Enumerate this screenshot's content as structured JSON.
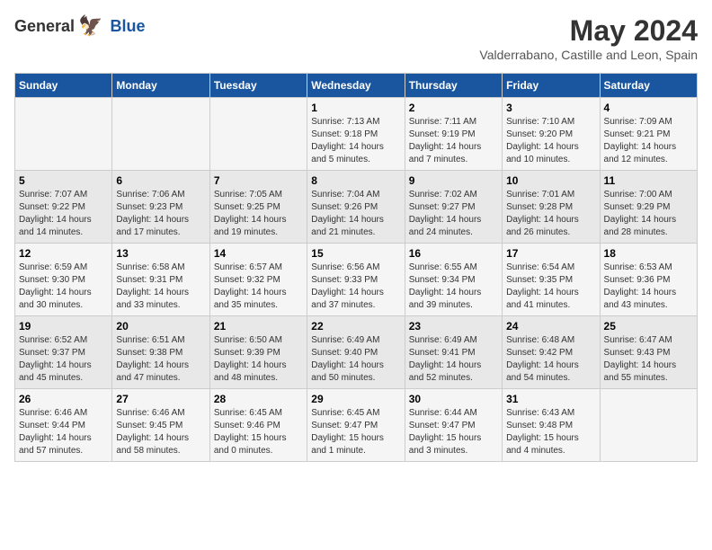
{
  "logo": {
    "general": "General",
    "blue": "Blue"
  },
  "title": "May 2024",
  "subtitle": "Valderrabano, Castille and Leon, Spain",
  "days_of_week": [
    "Sunday",
    "Monday",
    "Tuesday",
    "Wednesday",
    "Thursday",
    "Friday",
    "Saturday"
  ],
  "weeks": [
    [
      {
        "day": "",
        "info": ""
      },
      {
        "day": "",
        "info": ""
      },
      {
        "day": "",
        "info": ""
      },
      {
        "day": "1",
        "sunrise": "Sunrise: 7:13 AM",
        "sunset": "Sunset: 9:18 PM",
        "daylight": "Daylight: 14 hours and 5 minutes."
      },
      {
        "day": "2",
        "sunrise": "Sunrise: 7:11 AM",
        "sunset": "Sunset: 9:19 PM",
        "daylight": "Daylight: 14 hours and 7 minutes."
      },
      {
        "day": "3",
        "sunrise": "Sunrise: 7:10 AM",
        "sunset": "Sunset: 9:20 PM",
        "daylight": "Daylight: 14 hours and 10 minutes."
      },
      {
        "day": "4",
        "sunrise": "Sunrise: 7:09 AM",
        "sunset": "Sunset: 9:21 PM",
        "daylight": "Daylight: 14 hours and 12 minutes."
      }
    ],
    [
      {
        "day": "5",
        "sunrise": "Sunrise: 7:07 AM",
        "sunset": "Sunset: 9:22 PM",
        "daylight": "Daylight: 14 hours and 14 minutes."
      },
      {
        "day": "6",
        "sunrise": "Sunrise: 7:06 AM",
        "sunset": "Sunset: 9:23 PM",
        "daylight": "Daylight: 14 hours and 17 minutes."
      },
      {
        "day": "7",
        "sunrise": "Sunrise: 7:05 AM",
        "sunset": "Sunset: 9:25 PM",
        "daylight": "Daylight: 14 hours and 19 minutes."
      },
      {
        "day": "8",
        "sunrise": "Sunrise: 7:04 AM",
        "sunset": "Sunset: 9:26 PM",
        "daylight": "Daylight: 14 hours and 21 minutes."
      },
      {
        "day": "9",
        "sunrise": "Sunrise: 7:02 AM",
        "sunset": "Sunset: 9:27 PM",
        "daylight": "Daylight: 14 hours and 24 minutes."
      },
      {
        "day": "10",
        "sunrise": "Sunrise: 7:01 AM",
        "sunset": "Sunset: 9:28 PM",
        "daylight": "Daylight: 14 hours and 26 minutes."
      },
      {
        "day": "11",
        "sunrise": "Sunrise: 7:00 AM",
        "sunset": "Sunset: 9:29 PM",
        "daylight": "Daylight: 14 hours and 28 minutes."
      }
    ],
    [
      {
        "day": "12",
        "sunrise": "Sunrise: 6:59 AM",
        "sunset": "Sunset: 9:30 PM",
        "daylight": "Daylight: 14 hours and 30 minutes."
      },
      {
        "day": "13",
        "sunrise": "Sunrise: 6:58 AM",
        "sunset": "Sunset: 9:31 PM",
        "daylight": "Daylight: 14 hours and 33 minutes."
      },
      {
        "day": "14",
        "sunrise": "Sunrise: 6:57 AM",
        "sunset": "Sunset: 9:32 PM",
        "daylight": "Daylight: 14 hours and 35 minutes."
      },
      {
        "day": "15",
        "sunrise": "Sunrise: 6:56 AM",
        "sunset": "Sunset: 9:33 PM",
        "daylight": "Daylight: 14 hours and 37 minutes."
      },
      {
        "day": "16",
        "sunrise": "Sunrise: 6:55 AM",
        "sunset": "Sunset: 9:34 PM",
        "daylight": "Daylight: 14 hours and 39 minutes."
      },
      {
        "day": "17",
        "sunrise": "Sunrise: 6:54 AM",
        "sunset": "Sunset: 9:35 PM",
        "daylight": "Daylight: 14 hours and 41 minutes."
      },
      {
        "day": "18",
        "sunrise": "Sunrise: 6:53 AM",
        "sunset": "Sunset: 9:36 PM",
        "daylight": "Daylight: 14 hours and 43 minutes."
      }
    ],
    [
      {
        "day": "19",
        "sunrise": "Sunrise: 6:52 AM",
        "sunset": "Sunset: 9:37 PM",
        "daylight": "Daylight: 14 hours and 45 minutes."
      },
      {
        "day": "20",
        "sunrise": "Sunrise: 6:51 AM",
        "sunset": "Sunset: 9:38 PM",
        "daylight": "Daylight: 14 hours and 47 minutes."
      },
      {
        "day": "21",
        "sunrise": "Sunrise: 6:50 AM",
        "sunset": "Sunset: 9:39 PM",
        "daylight": "Daylight: 14 hours and 48 minutes."
      },
      {
        "day": "22",
        "sunrise": "Sunrise: 6:49 AM",
        "sunset": "Sunset: 9:40 PM",
        "daylight": "Daylight: 14 hours and 50 minutes."
      },
      {
        "day": "23",
        "sunrise": "Sunrise: 6:49 AM",
        "sunset": "Sunset: 9:41 PM",
        "daylight": "Daylight: 14 hours and 52 minutes."
      },
      {
        "day": "24",
        "sunrise": "Sunrise: 6:48 AM",
        "sunset": "Sunset: 9:42 PM",
        "daylight": "Daylight: 14 hours and 54 minutes."
      },
      {
        "day": "25",
        "sunrise": "Sunrise: 6:47 AM",
        "sunset": "Sunset: 9:43 PM",
        "daylight": "Daylight: 14 hours and 55 minutes."
      }
    ],
    [
      {
        "day": "26",
        "sunrise": "Sunrise: 6:46 AM",
        "sunset": "Sunset: 9:44 PM",
        "daylight": "Daylight: 14 hours and 57 minutes."
      },
      {
        "day": "27",
        "sunrise": "Sunrise: 6:46 AM",
        "sunset": "Sunset: 9:45 PM",
        "daylight": "Daylight: 14 hours and 58 minutes."
      },
      {
        "day": "28",
        "sunrise": "Sunrise: 6:45 AM",
        "sunset": "Sunset: 9:46 PM",
        "daylight": "Daylight: 15 hours and 0 minutes."
      },
      {
        "day": "29",
        "sunrise": "Sunrise: 6:45 AM",
        "sunset": "Sunset: 9:47 PM",
        "daylight": "Daylight: 15 hours and 1 minute."
      },
      {
        "day": "30",
        "sunrise": "Sunrise: 6:44 AM",
        "sunset": "Sunset: 9:47 PM",
        "daylight": "Daylight: 15 hours and 3 minutes."
      },
      {
        "day": "31",
        "sunrise": "Sunrise: 6:43 AM",
        "sunset": "Sunset: 9:48 PM",
        "daylight": "Daylight: 15 hours and 4 minutes."
      },
      {
        "day": "",
        "info": ""
      }
    ]
  ]
}
